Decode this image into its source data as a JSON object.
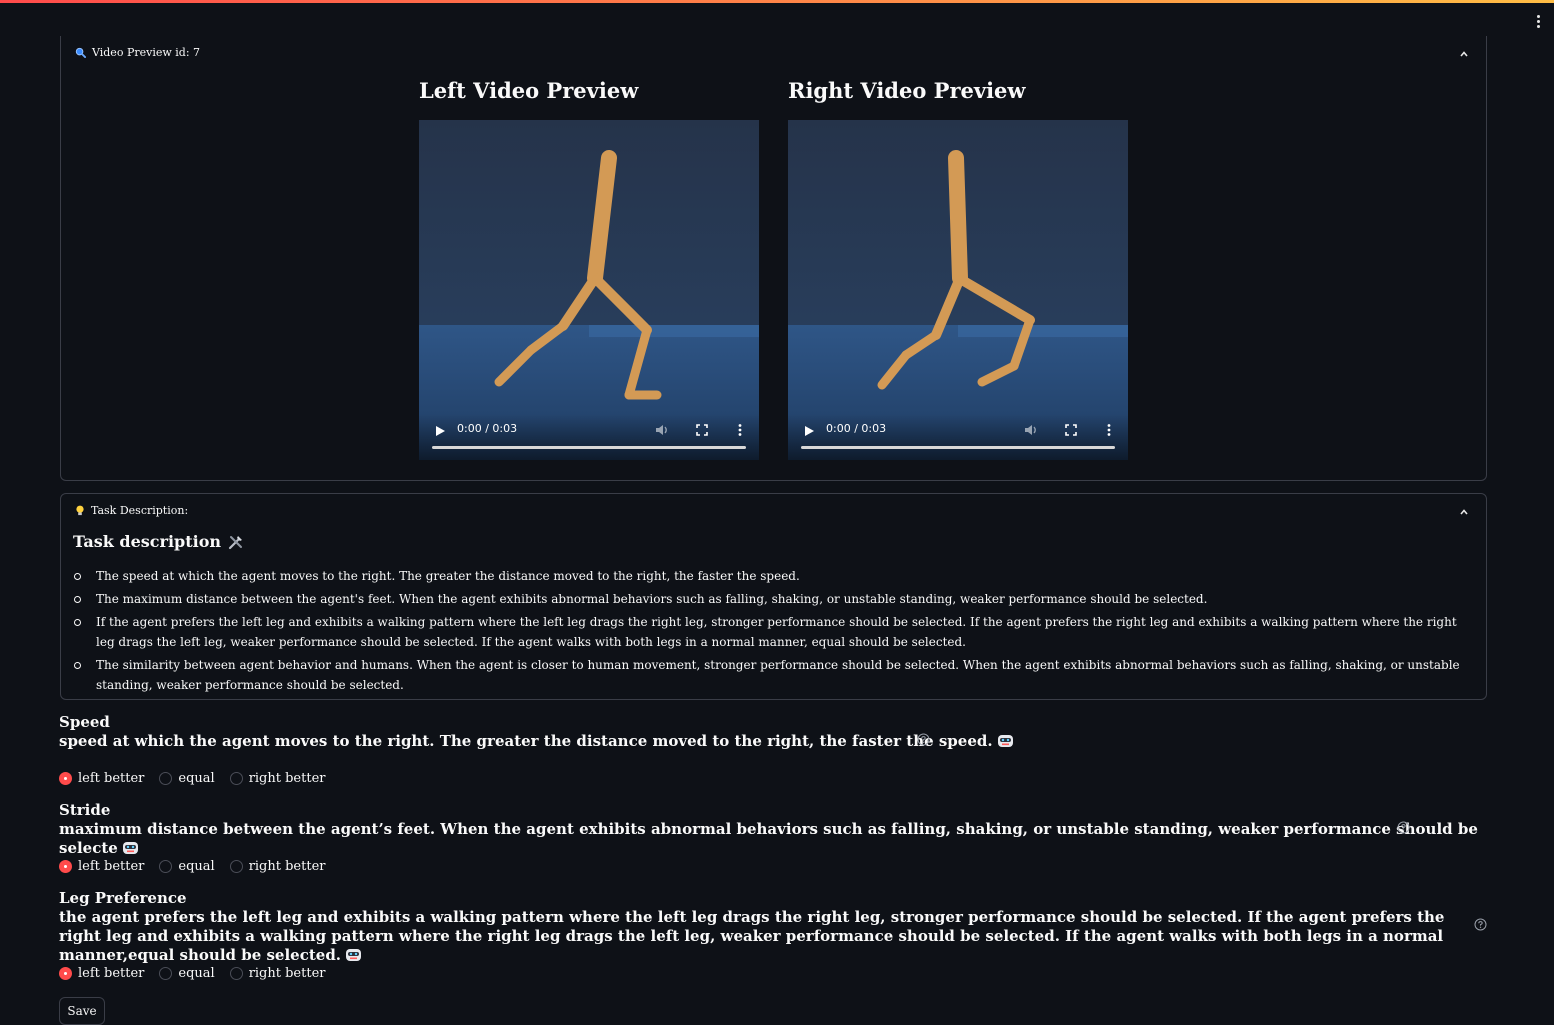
{
  "video_section": {
    "header": "Video Preview id: 7",
    "left": {
      "title": "Left Video Preview",
      "time": "0:00 / 0:03"
    },
    "right": {
      "title": "Right Video Preview",
      "time": "0:00 / 0:03"
    }
  },
  "task_section": {
    "header": "Task Description:",
    "title": "Task description",
    "items": [
      "The speed at which the agent moves to the right. The greater the distance moved to the right, the faster the speed.",
      "The maximum distance between the agent's feet. When the agent exhibits abnormal behaviors such as falling, shaking, or unstable standing, weaker performance should be selected.",
      "If the agent prefers the left leg and exhibits a walking pattern where the left leg drags the right leg, stronger performance should be selected. If the agent prefers the right leg and exhibits a walking pattern where the right leg drags the left leg, weaker performance should be selected. If the agent walks with both legs in a normal manner, equal should be selected.",
      "The similarity between agent behavior and humans. When the agent is closer to human movement, stronger performance should be selected. When the agent exhibits abnormal behaviors such as falling, shaking, or unstable standing, weaker performance should be selected."
    ]
  },
  "questions": [
    {
      "label": "Speed",
      "description": "speed at which the agent moves to the right. The greater the distance moved to the right, the faster the speed.",
      "options": [
        "left better",
        "equal",
        "right better"
      ],
      "selected": "left better"
    },
    {
      "label": "Stride",
      "description": "maximum distance between the agent’s feet. When the agent exhibits abnormal behaviors such as falling, shaking, or unstable standing, weaker performance should be selecte",
      "options": [
        "left better",
        "equal",
        "right better"
      ],
      "selected": "left better"
    },
    {
      "label": "Leg Preference",
      "description": "the agent prefers the left leg and exhibits a walking pattern where the left leg drags the right leg, stronger performance should be selected. If the agent prefers the right leg and exhibits a walking pattern where the right leg drags the left leg, weaker performance should be selected. If the agent walks with both legs in a normal manner,equal should be selected.",
      "options": [
        "left better",
        "equal",
        "right better"
      ],
      "selected": "left better"
    }
  ],
  "save_label": "Save",
  "colors": {
    "background": "#0e1117",
    "border": "#3a3d47",
    "accent": "#ff4b4b",
    "text": "#fafafa"
  },
  "icons": {
    "video_header": "magnifier-icon",
    "task_header": "lightbulb-icon",
    "task_title": "tools-icon",
    "description_emoji": "robot-icon",
    "help": "question-circle-icon"
  }
}
